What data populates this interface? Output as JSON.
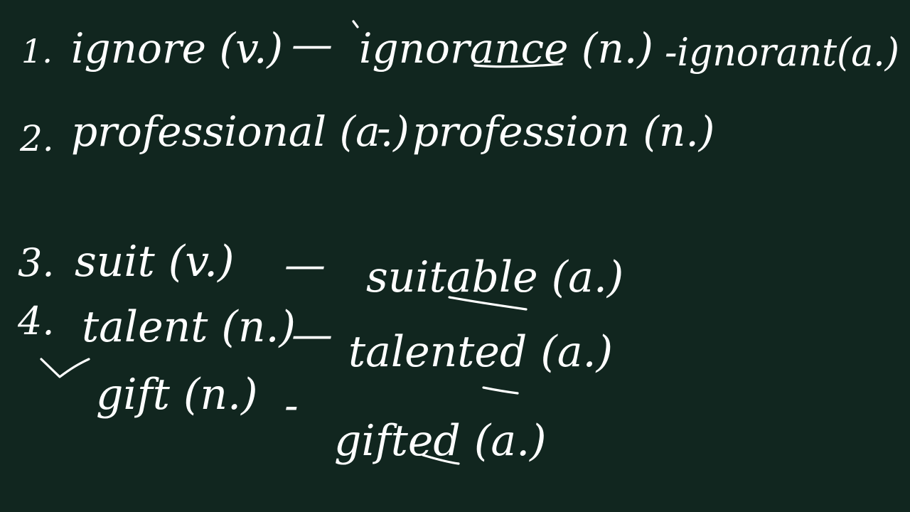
{
  "background_color": "#11261f",
  "ink_color": "#ffffff",
  "lines": [
    {
      "number": "1.",
      "segments": [
        {
          "text": "ignore (v.)"
        },
        {
          "text": "—"
        },
        {
          "text": "ignorance (n.)"
        },
        {
          "text": "-ignorant(a.)"
        }
      ]
    },
    {
      "number": "2.",
      "segments": [
        {
          "text": "professional (a.)"
        },
        {
          "text": "-"
        },
        {
          "text": "profession (n.)"
        }
      ]
    },
    {
      "number": "3.",
      "segments": [
        {
          "text": "suit (v.)"
        },
        {
          "text": "—"
        },
        {
          "text": "suitable (a.)"
        }
      ]
    },
    {
      "number": "4.",
      "segments": [
        {
          "text": "talent (n.)"
        },
        {
          "text": "—"
        },
        {
          "text": "talented (a.)"
        }
      ]
    },
    {
      "number": "",
      "segments": [
        {
          "text": "gift (n.)"
        },
        {
          "text": "-"
        },
        {
          "text": "gifted (a.)"
        }
      ]
    }
  ],
  "icons": [
    "checkmark-icon"
  ]
}
